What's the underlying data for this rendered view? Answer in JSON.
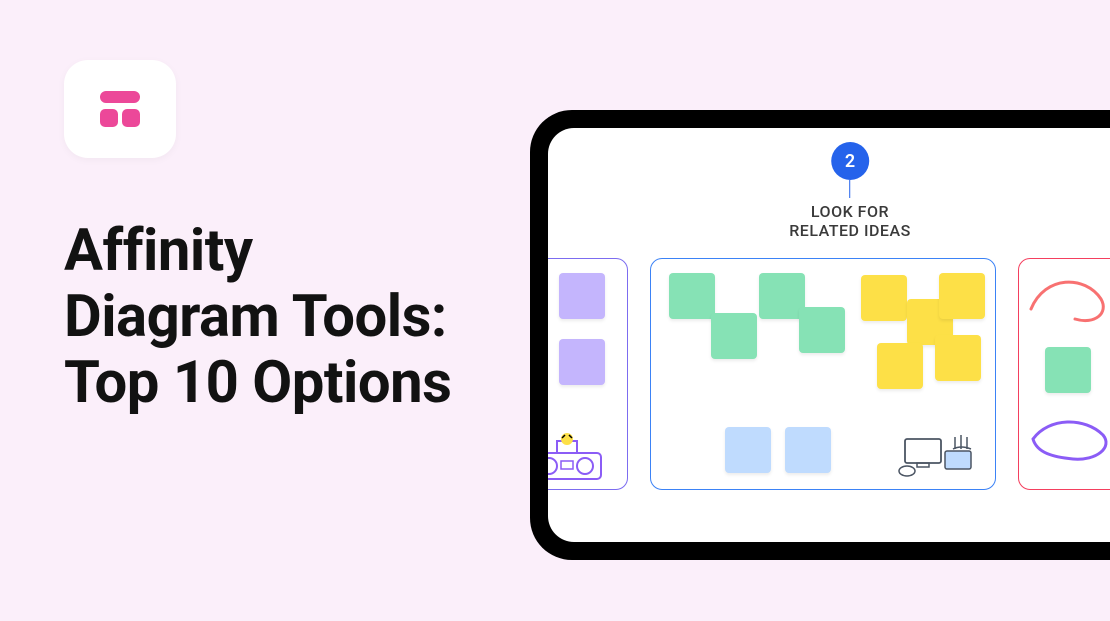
{
  "page": {
    "title": "Affinity\nDiagram Tools:\nTop 10 Options"
  },
  "step": {
    "number": "2",
    "title_line1": "LOOK FOR",
    "title_line2": "RELATED IDEAS"
  }
}
